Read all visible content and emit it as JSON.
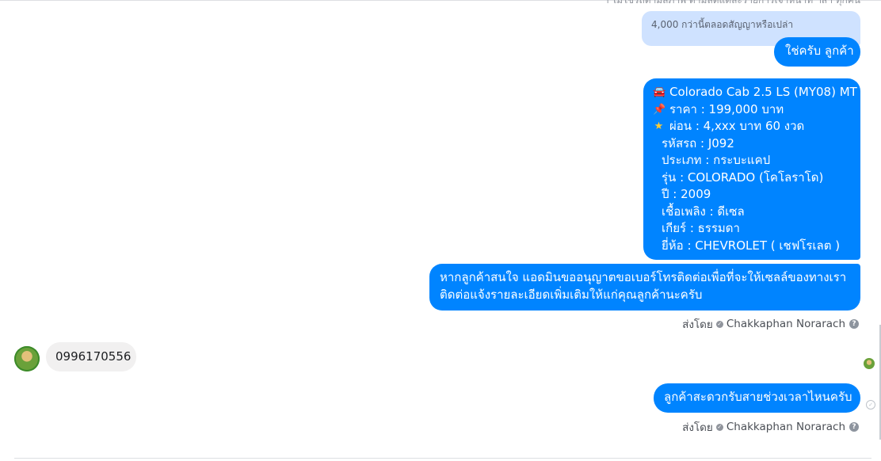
{
  "conversation": {
    "top_cut_text": "ฯ ไม่ใช่รถตามสภาพ ตามลดแต่ละรายการเจ้าหน้าที่ ฯลฯ ทุกคัน",
    "replied_message": "4,000 กว่านี้ตลอดสัญญาหรือเปล่า",
    "reply_yes": "ใช่ครับ ลูกค้า",
    "car_listing": {
      "title": "Colorado Cab 2.5 LS (MY08) MT",
      "price": "ราคา : 199,000 บาท",
      "installment": "ผ่อน : 4,xxx บาท 60 งวด",
      "code": "รหัสรถ : J092",
      "type": "ประเภท : กระบะแคป",
      "model": "รุ่น : COLORADO (โคโลราโด)",
      "year": "ปี : 2009",
      "fuel": "เชื้อเพลิง : ดีเซล",
      "gear": "เกียร์ : ธรรมดา",
      "brand": "ยี่ห้อ : CHEVROLET ( เชฟโรเลต )",
      "icons": [
        "car-icon",
        "pushpin-icon",
        "star-icon"
      ]
    },
    "permission_message": "หากลูกค้าสนใจ แอดมินขออนุญาตขอเบอร์โทรติดต่อเพื่อที่จะให้เซลล์ของทางเราติดต่อแจ้งรายละเอียดเพิ่มเติมให้แก่คุณลูกค้านะครับ",
    "sent_by_label": "ส่งโดย",
    "sent_by_name": "Chakkaphan Norarach",
    "customer_phone": "0996170556",
    "ask_time": "ลูกค้าสะดวกรับสายช่วงเวลาไหนครับ"
  },
  "colors": {
    "outgoing_bubble": "#0084ff",
    "incoming_bubble": "#f1f0f0",
    "reply_preview": "#cfe2ff"
  }
}
